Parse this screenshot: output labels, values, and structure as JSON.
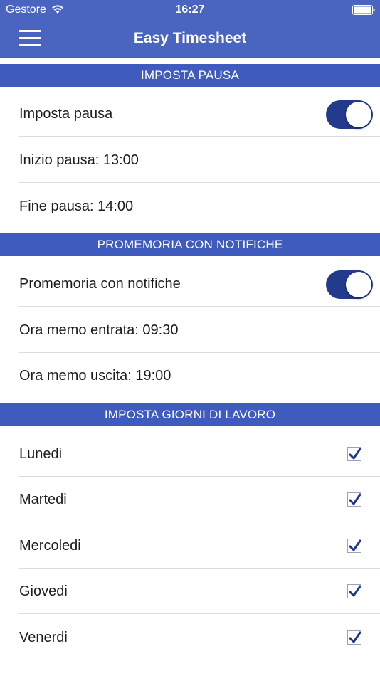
{
  "status_bar": {
    "carrier": "Gestore",
    "time": "16:27"
  },
  "app": {
    "title": "Easy Timesheet",
    "brand_color": "#4a65bf",
    "toggle_on_color": "#243a8c"
  },
  "sections": {
    "pause": {
      "header": "IMPOSTA PAUSA",
      "toggle_label": "Imposta pausa",
      "toggle_on": true,
      "start": "Inizio pausa: 13:00",
      "end": "Fine pausa: 14:00"
    },
    "notifications": {
      "header": "PROMEMORIA CON NOTIFICHE",
      "toggle_label": "Promemoria con notifiche",
      "toggle_on": true,
      "entry": "Ora memo entrata: 09:30",
      "exit": "Ora memo uscita: 19:00"
    },
    "workdays": {
      "header": "IMPOSTA GIORNI DI LAVORO",
      "days": [
        {
          "label": "Lunedi",
          "checked": true
        },
        {
          "label": "Martedi",
          "checked": true
        },
        {
          "label": "Mercoledi",
          "checked": true
        },
        {
          "label": "Giovedi",
          "checked": true
        },
        {
          "label": "Venerdi",
          "checked": true
        }
      ]
    }
  }
}
